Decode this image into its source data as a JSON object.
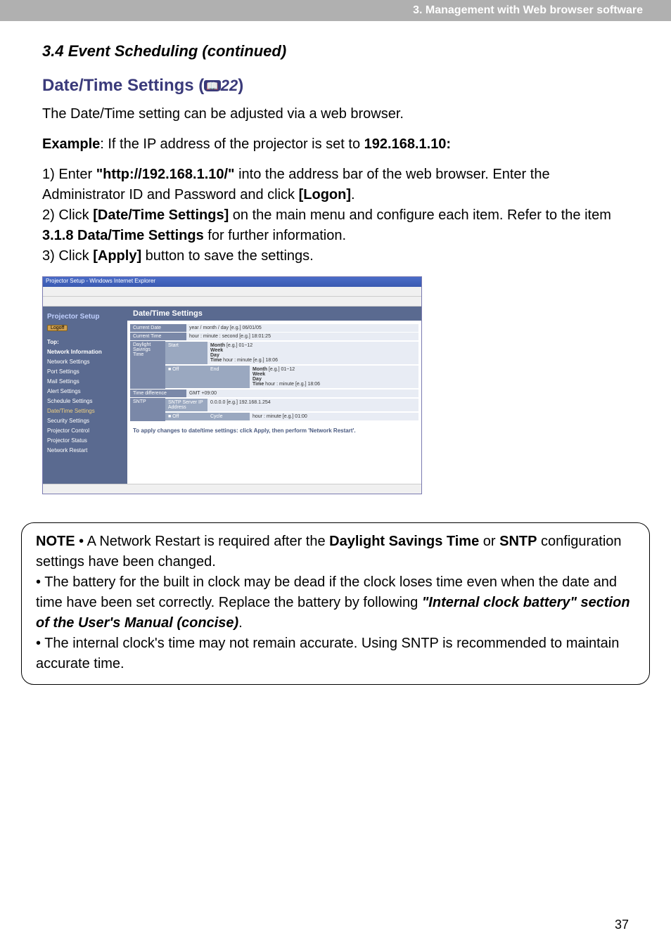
{
  "header": {
    "breadcrumb": "3. Management with Web browser software"
  },
  "titles": {
    "section": "3.4 Event Scheduling (continued)",
    "subsection_prefix": "Date/Time Settings (",
    "subsection_ref": "22",
    "subsection_suffix": ")"
  },
  "intro": "The Date/Time setting can be adjusted via a web browser.",
  "example": {
    "label": "Example",
    "text_after_label": ": If the IP address of the projector is set to ",
    "ip": "192.168.1.10:"
  },
  "step1": {
    "prefix": "1) Enter ",
    "url": "\"http://192.168.1.10/\"",
    "mid": " into the address bar of the web browser. Enter the Administrator ID and Password and click ",
    "logon": "[Logon]",
    "end": "."
  },
  "step2": {
    "prefix": "2) Click ",
    "link": "[Date/Time Settings]",
    "mid": " on the main menu and configure each item. Refer to the item ",
    "ref": "3.1.8 Data/Time Settings",
    "end": " for further information."
  },
  "step3": {
    "prefix": "3) Click ",
    "button": "[Apply]",
    "end": " button to save the settings."
  },
  "screenshot": {
    "titlebar": "Projector Setup - Windows Internet Explorer",
    "panel_title": "Date/Time Settings",
    "logoff": "Logoff",
    "sidebar": [
      "Top:",
      "Network Information",
      "Network Settings",
      "Port Settings",
      "Mail Settings",
      "Alert Settings",
      "Schedule Settings",
      "Date/Time Settings",
      "Security Settings",
      "Projector Control",
      "Projector Status",
      "Network Restart"
    ],
    "rows": {
      "current_date": "Current Date",
      "current_date_val": "year / month / day  [e.g.] 06/01/05",
      "current_time": "Current Time",
      "current_time_val": "hour : minute : second  [e.g.] 18:01:25",
      "dst": "Daylight Savings Time",
      "off": "■ Off",
      "start": "Start",
      "end": "End",
      "month_l": "Month",
      "month_v": "[e.g.] 01~12",
      "week_l": "Week",
      "day_l": "Day",
      "time_l": "Time",
      "time_v": "hour : minute  [e.g.] 18:06",
      "tdiff": "Time difference",
      "tdiff_v": "GMT +09:00",
      "sntp": "SNTP",
      "sntp_server": "SNTP Server IP Address",
      "sntp_server_v": "0.0.0.0   [e.g.] 192.168.1.254",
      "cycle": "Cycle",
      "cycle_v": "hour : minute  [e.g.] 01:00"
    },
    "footer": "To apply changes to date/time settings: click Apply, then perform 'Network Restart'."
  },
  "note": {
    "label": "NOTE",
    "line1a": " • A Network Restart is required after the ",
    "line1b": "Daylight Savings Time",
    "line1c": " or ",
    "line1d": "SNTP",
    "line1e": " configuration settings have been changed.",
    "line2": "• The battery for the built in clock may be dead if the clock loses time even when the date and time have been set correctly. Replace the battery by following ",
    "line2b": "\"Internal clock battery\" section of the User's Manual (concise)",
    "line2c": ".",
    "line3": "• The internal clock's time may not remain accurate. Using SNTP is recommended to maintain accurate time."
  },
  "page": "37"
}
